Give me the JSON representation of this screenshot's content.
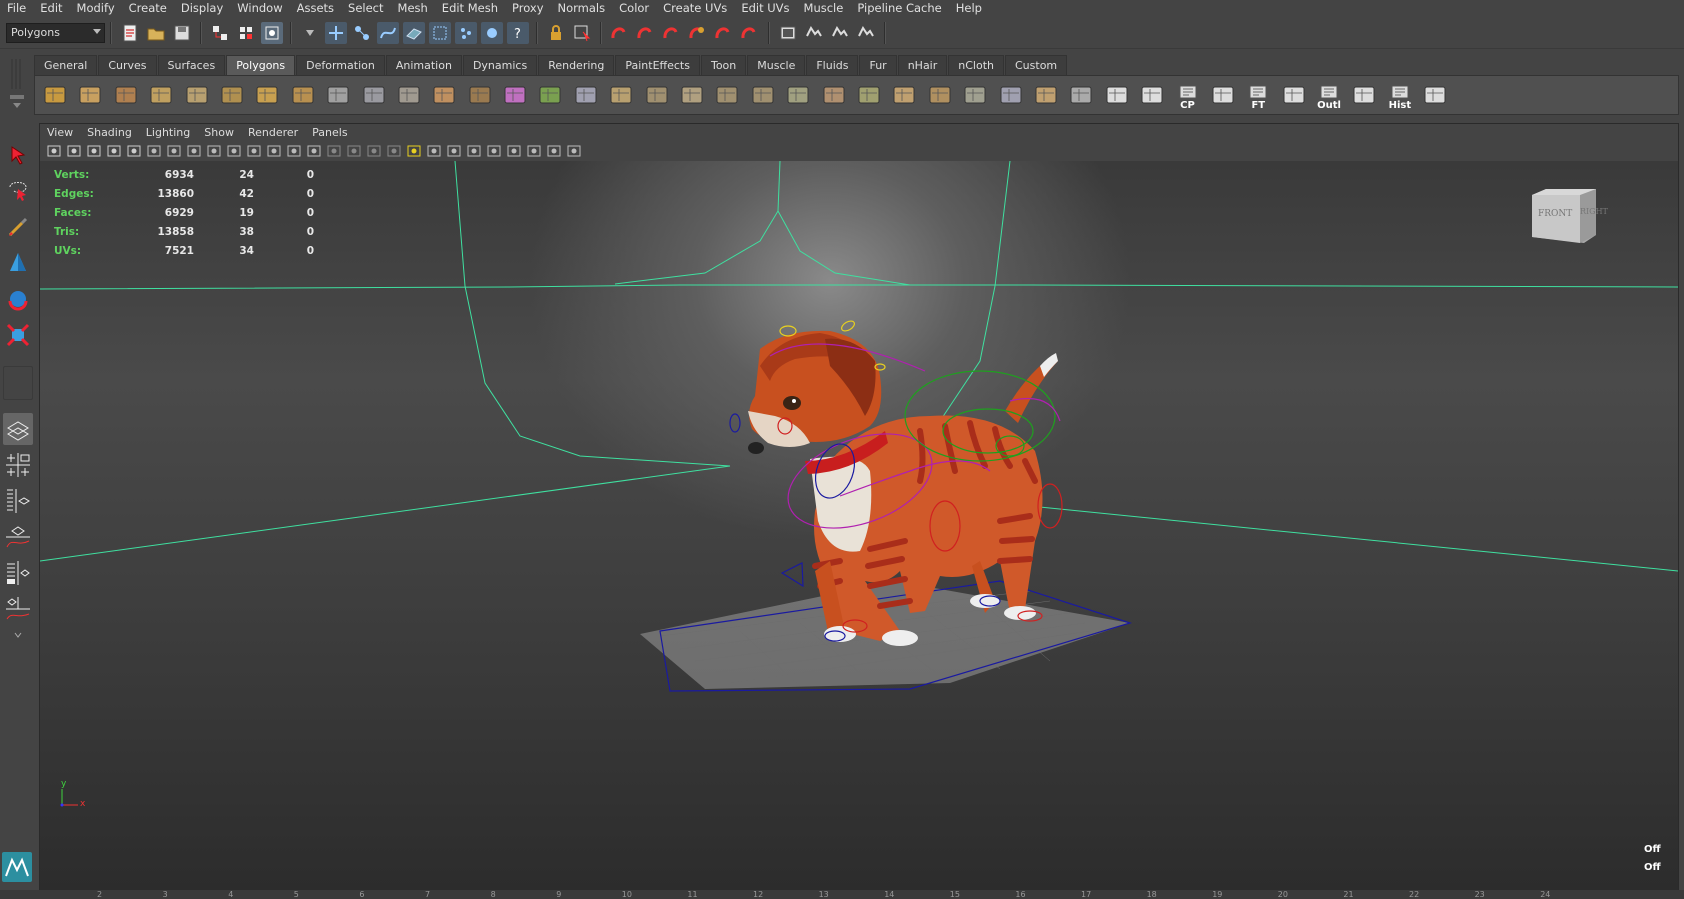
{
  "menubar": {
    "items": [
      "File",
      "Edit",
      "Modify",
      "Create",
      "Display",
      "Window",
      "Assets",
      "Select",
      "Mesh",
      "Edit Mesh",
      "Proxy",
      "Normals",
      "Color",
      "Create UVs",
      "Edit UVs",
      "Muscle",
      "Pipeline Cache",
      "Help"
    ]
  },
  "statusline": {
    "mode": "Polygons"
  },
  "shelf": {
    "tabs": [
      "General",
      "Curves",
      "Surfaces",
      "Polygons",
      "Deformation",
      "Animation",
      "Dynamics",
      "Rendering",
      "PaintEffects",
      "Toon",
      "Muscle",
      "Fluids",
      "Fur",
      "nHair",
      "nCloth",
      "Custom"
    ],
    "active_tab": "Polygons",
    "labeled_icons": [
      "CP",
      "FT",
      "Outl",
      "Hist"
    ]
  },
  "panel": {
    "menu": [
      "View",
      "Shading",
      "Lighting",
      "Show",
      "Renderer",
      "Panels"
    ]
  },
  "hud": {
    "rows": [
      {
        "label": "Verts:",
        "total": "6934",
        "selected": "24",
        "other": "0"
      },
      {
        "label": "Edges:",
        "total": "13860",
        "selected": "42",
        "other": "0"
      },
      {
        "label": "Faces:",
        "total": "6929",
        "selected": "19",
        "other": "0"
      },
      {
        "label": "Tris:",
        "total": "13858",
        "selected": "38",
        "other": "0"
      },
      {
        "label": "UVs:",
        "total": "7521",
        "selected": "34",
        "other": "0"
      }
    ]
  },
  "viewcube": {
    "front": "FRONT",
    "right": "RIGHT"
  },
  "axis": {
    "x": "x",
    "y": "y"
  },
  "hud_right": {
    "values": [
      "Off",
      "Off"
    ]
  },
  "timeslider": {
    "ticks": [
      "2",
      "3",
      "4",
      "5",
      "6",
      "7",
      "8",
      "9",
      "10",
      "11",
      "12",
      "13",
      "14",
      "15",
      "16",
      "17",
      "18",
      "19",
      "20",
      "21",
      "22",
      "23",
      "24"
    ]
  },
  "colors": {
    "hud_label": "#5fd35f",
    "accent": "#4a9fd8",
    "grid_curves": "#3fe0a0"
  }
}
